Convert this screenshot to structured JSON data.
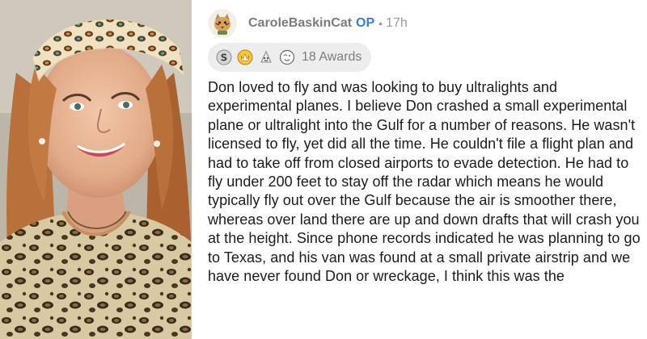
{
  "post": {
    "username": "CaroleBaskinCat",
    "op_badge": "OP",
    "separator": "•",
    "time_ago": "17h",
    "awards_count": "18 Awards",
    "awards": [
      "silver-award-icon",
      "gold-award-icon",
      "wholesome-award-icon",
      "helpful-award-icon"
    ],
    "body": "Don loved to fly and was looking to buy ultralights and experimental planes.  I believe Don crashed a small experimental plane or ultralight into the Gulf for a number of reasons.  He wasn't licensed to fly, yet did all the time.  He couldn't file a flight plan and had to take off from closed airports to evade detection.  He had to fly under 200 feet to stay off the radar which means he would typically fly out over the Gulf because the air is smoother there, whereas over land there are up and down drafts that will crash you at the height.  Since phone records indicated he was planning to go to Texas, and his van was found at a small private airstrip and we have never found Don or wreckage, I think this was the"
  },
  "colors": {
    "username": "#7c7c7c",
    "op_badge": "#3a7bd5",
    "text": "#1c1c1c",
    "awards_pill": "#ededed"
  }
}
